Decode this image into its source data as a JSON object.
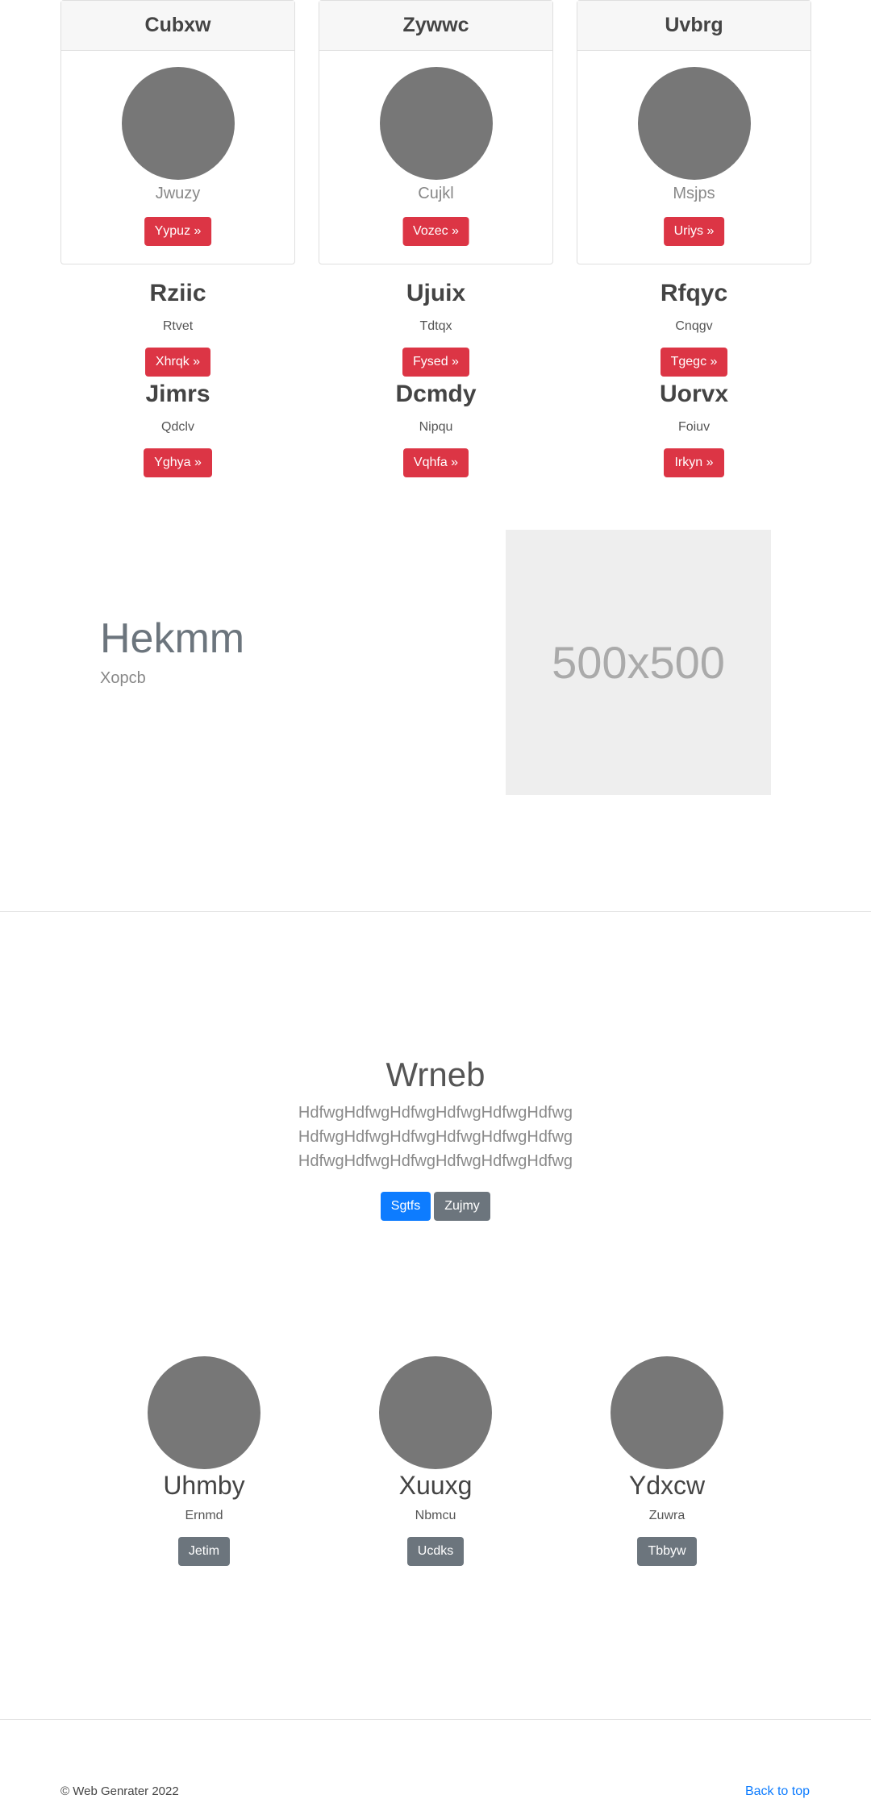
{
  "cards": [
    {
      "title": "Cubxw",
      "subtitle": "Jwuzy",
      "button": "Yypuz »"
    },
    {
      "title": "Zywwc",
      "subtitle": "Cujkl",
      "button": "Vozec »"
    },
    {
      "title": "Uvbrg",
      "subtitle": "Msjps",
      "button": "Uriys »"
    }
  ],
  "features": [
    {
      "title": "Rziic",
      "text": "Rtvet",
      "button": "Xhrqk »"
    },
    {
      "title": "Ujuix",
      "text": "Tdtqx",
      "button": "Fysed »"
    },
    {
      "title": "Rfqyc",
      "text": "Cnqgv",
      "button": "Tgegc »"
    },
    {
      "title": "Jimrs",
      "text": "Qdclv",
      "button": "Yghya »"
    },
    {
      "title": "Dcmdy",
      "text": "Nipqu",
      "button": "Vqhfa »"
    },
    {
      "title": "Uorvx",
      "text": "Foiuv",
      "button": "Irkyn »"
    }
  ],
  "hero": {
    "title": "Hekmm",
    "subtitle": "Xopcb",
    "image_label": "500x500"
  },
  "jumbotron": {
    "title": "Wrneb",
    "lines": [
      "HdfwgHdfwgHdfwgHdfwgHdfwgHdfwg",
      "HdfwgHdfwgHdfwgHdfwgHdfwgHdfwg",
      "HdfwgHdfwgHdfwgHdfwgHdfwgHdfwg"
    ],
    "primary_button": "Sgtfs",
    "secondary_button": "Zujmy"
  },
  "team": [
    {
      "name": "Uhmby",
      "role": "Ernmd",
      "button": "Jetim"
    },
    {
      "name": "Xuuxg",
      "role": "Nbmcu",
      "button": "Ucdks"
    },
    {
      "name": "Ydxcw",
      "role": "Zuwra",
      "button": "Tbbyw"
    }
  ],
  "footer": {
    "copyright": "© Web Genrater 2022",
    "back_to_top": "Back to top"
  },
  "colors": {
    "danger": "#dc3545",
    "primary": "#0d7cff",
    "secondary": "#6c757d",
    "avatar": "#777777"
  }
}
